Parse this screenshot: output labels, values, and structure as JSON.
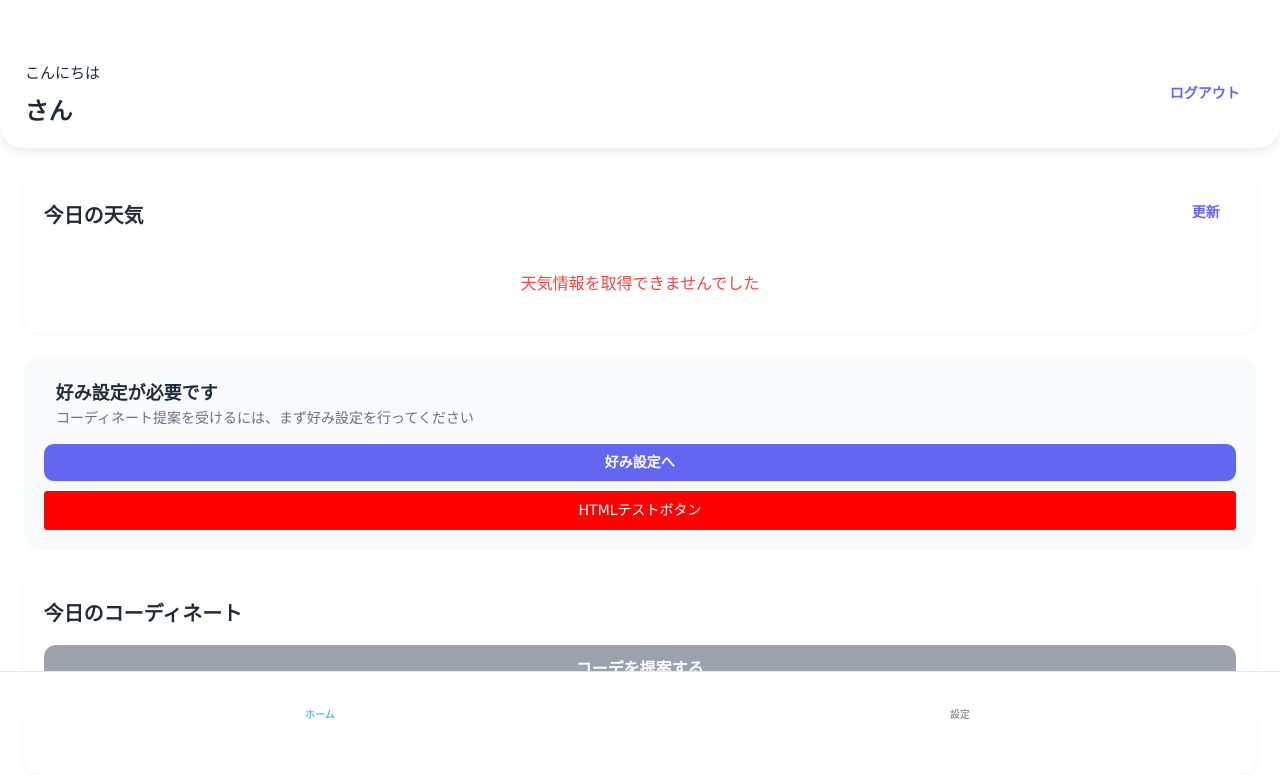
{
  "header": {
    "greeting": "こんにちは",
    "username": "さん",
    "logout_label": "ログアウト"
  },
  "weather": {
    "title": "今日の天気",
    "refresh_label": "更新",
    "error_message": "天気情報を取得できませんでした"
  },
  "preferences": {
    "title": "好み設定が必要です",
    "description": "コーディネート提案を受けるには、まず好み設定を行ってください",
    "settings_button_label": "好み設定へ",
    "test_button_label": "HTMLテストボタン"
  },
  "coordinate": {
    "title": "今日のコーディネート",
    "suggest_button_label": "コーデを提案する"
  },
  "bottom_nav": {
    "items": [
      {
        "label": "ホーム",
        "active": true
      },
      {
        "label": "設定",
        "active": false
      }
    ]
  },
  "colors": {
    "accent": "#6366f1",
    "error": "#ef4444",
    "test_button": "#ff0000",
    "disabled_button": "#9ca3af",
    "nav_active": "#0ea5e9"
  }
}
